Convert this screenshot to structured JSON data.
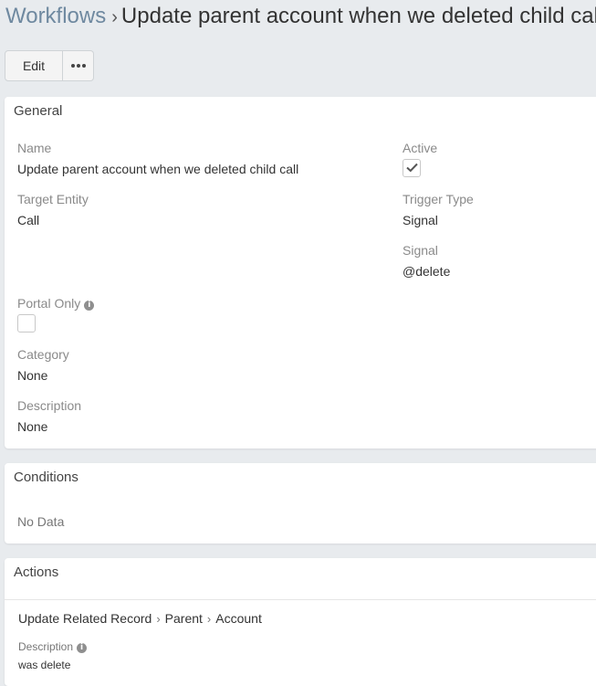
{
  "header": {
    "breadcrumb_link": "Workflows",
    "separator": "›",
    "title": "Update parent account when we deleted child call"
  },
  "toolbar": {
    "edit_label": "Edit",
    "more_icon": "ellipsis-icon"
  },
  "general": {
    "title": "General",
    "name": {
      "label": "Name",
      "value": "Update parent account when we deleted child call"
    },
    "active": {
      "label": "Active",
      "checked": true
    },
    "target_entity": {
      "label": "Target Entity",
      "value": "Call"
    },
    "trigger_type": {
      "label": "Trigger Type",
      "value": "Signal"
    },
    "signal": {
      "label": "Signal",
      "value": "@delete"
    },
    "portal_only": {
      "label": "Portal Only",
      "checked": false,
      "icon": "info-icon"
    },
    "category": {
      "label": "Category",
      "value": "None"
    },
    "description": {
      "label": "Description",
      "value": "None"
    }
  },
  "conditions": {
    "title": "Conditions",
    "empty_text": "No Data"
  },
  "actions": {
    "title": "Actions",
    "items": [
      {
        "path": [
          "Update Related Record",
          "Parent",
          "Account"
        ],
        "description_label": "Description",
        "description_value": "was delete"
      }
    ]
  },
  "colors": {
    "page_background": "#e8ebee",
    "breadcrumb_link": "#6f89a0",
    "label_gray": "#8a8a8a"
  }
}
